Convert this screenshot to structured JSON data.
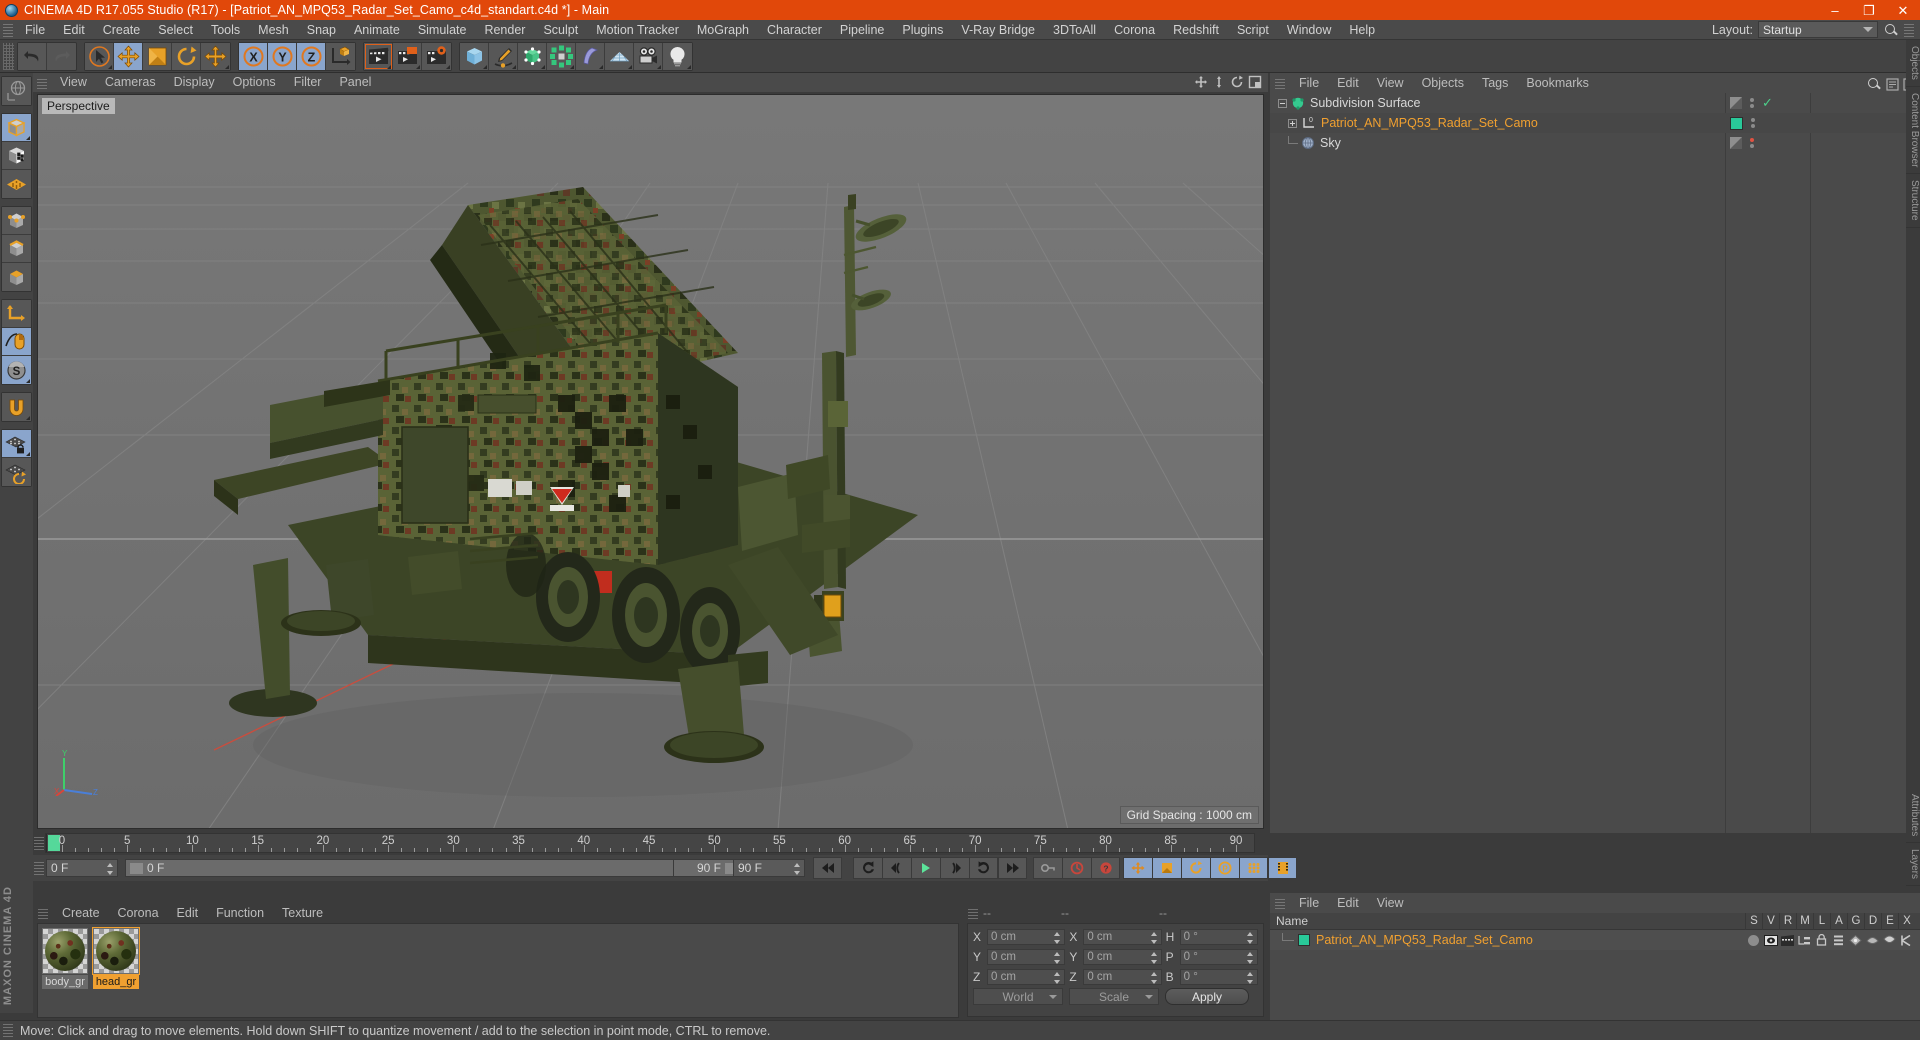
{
  "titlebar": {
    "title": "CINEMA 4D R17.055 Studio (R17) - [Patriot_AN_MPQ53_Radar_Set_Camo_c4d_standart.c4d *] - Main",
    "minimize": "–",
    "maximize": "❐",
    "close": "✕"
  },
  "menubar": {
    "items": [
      "File",
      "Edit",
      "Create",
      "Select",
      "Tools",
      "Mesh",
      "Snap",
      "Animate",
      "Simulate",
      "Render",
      "Sculpt",
      "Motion Tracker",
      "MoGraph",
      "Character",
      "Pipeline",
      "Plugins",
      "V-Ray Bridge",
      "3DToAll",
      "Corona",
      "Redshift",
      "Script",
      "Window",
      "Help"
    ],
    "layout_label": "Layout:",
    "layout_value": "Startup"
  },
  "viewport": {
    "menus": [
      "View",
      "Cameras",
      "Display",
      "Options",
      "Filter",
      "Panel"
    ],
    "label": "Perspective",
    "grid_spacing": "Grid Spacing : 1000 cm"
  },
  "object_manager": {
    "menus": [
      "File",
      "Edit",
      "View",
      "Objects",
      "Tags",
      "Bookmarks"
    ],
    "items": [
      {
        "name": "Subdivision Surface",
        "selected": false,
        "icon": "subdivision-surface-icon",
        "indent": 0
      },
      {
        "name": "Patriot_AN_MPQ53_Radar_Set_Camo",
        "selected": true,
        "icon": "null-object-icon",
        "indent": 1
      },
      {
        "name": "Sky",
        "selected": false,
        "icon": "sky-icon",
        "indent": 1
      }
    ]
  },
  "timeline": {
    "ticks": [
      0,
      5,
      10,
      15,
      20,
      25,
      30,
      35,
      40,
      45,
      50,
      55,
      60,
      65,
      70,
      75,
      80,
      85,
      90
    ],
    "current_frame": "0 F",
    "current_frame_field": "0 F",
    "end_frame_display": "90 F",
    "end_frame": "90 F",
    "preview_min": "0 F",
    "preview_max": "90 F"
  },
  "material_manager": {
    "menus": [
      "Create",
      "Corona",
      "Edit",
      "Function",
      "Texture"
    ],
    "materials": [
      {
        "name": "body_gr",
        "selected": false
      },
      {
        "name": "head_gr",
        "selected": true
      }
    ]
  },
  "coordinates": {
    "headers": [
      "--",
      "--",
      "--"
    ],
    "rows": [
      {
        "pos_label": "X",
        "pos_value": "0 cm",
        "size_label": "X",
        "size_value": "0 cm",
        "rot_label": "H",
        "rot_value": "0 °"
      },
      {
        "pos_label": "Y",
        "pos_value": "0 cm",
        "size_label": "Y",
        "size_value": "0 cm",
        "rot_label": "P",
        "rot_value": "0 °"
      },
      {
        "pos_label": "Z",
        "pos_value": "0 cm",
        "size_label": "Z",
        "size_value": "0 cm",
        "rot_label": "B",
        "rot_value": "0 °"
      }
    ],
    "space": "World",
    "mode": "Scale",
    "apply": "Apply"
  },
  "attribute_manager": {
    "menus": [
      "File",
      "Edit",
      "View"
    ],
    "name_column": "Name",
    "columns": [
      "S",
      "V",
      "R",
      "M",
      "L",
      "A",
      "G",
      "D",
      "E",
      "X"
    ],
    "row_name": "Patriot_AN_MPQ53_Radar_Set_Camo"
  },
  "statusbar": {
    "text": "Move: Click and drag to move elements. Hold down SHIFT to quantize movement / add to the selection in point mode, CTRL to remove."
  },
  "right_tabs": [
    "Objects",
    "Content Browser",
    "Structure",
    "Attributes",
    "Layers"
  ],
  "colors": {
    "accent_orange": "#e1480a",
    "selection_blue": "#8aa5cc",
    "selected_text": "#f0a030",
    "green_tag": "#29c999",
    "panel_bg": "#434343",
    "viewport_bg": "#717171"
  },
  "left_toolbar_icons": [
    "undo-icon",
    "redo-icon",
    "live-selection-icon",
    "move-icon",
    "scale-icon",
    "rotate-icon",
    "move-alt-icon",
    "x-axis-icon",
    "y-axis-icon",
    "z-axis-icon",
    "world-coordinate-icon",
    "render-view-icon",
    "render-region-icon",
    "render-picture-viewer-icon",
    "render-settings-icon",
    "primitive-cube-icon",
    "spline-pen-icon",
    "generator-icon",
    "mograph-icon",
    "deformer-icon",
    "scene-floor-icon",
    "camera-icon",
    "light-icon"
  ],
  "left_vertical_icons": [
    "world-axis-icon",
    "model-mode-icon",
    "texture-mode-icon",
    "workplane-icon",
    "point-mode-icon",
    "edge-mode-icon",
    "polygon-mode-icon",
    "object-axis-icon",
    "viewport-solo-icon",
    "enable-axis-icon",
    "magnet-icon",
    "workplane-lock-icon",
    "planar-workplane-icon"
  ],
  "playback_icons": [
    "go-to-start-icon",
    "step-back-key-icon",
    "play-back-icon",
    "play-icon",
    "play-forward-icon",
    "step-forward-key-icon",
    "go-to-end-icon"
  ]
}
